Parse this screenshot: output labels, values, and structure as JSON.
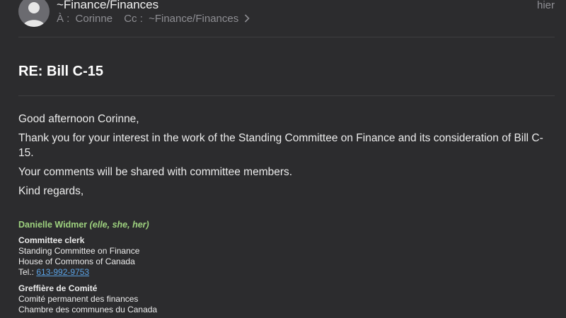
{
  "header": {
    "sender": "~Finance/Finances",
    "date": "hier",
    "to_label": "À :",
    "to_value": "Corinne",
    "cc_label": "Cc :",
    "cc_value": "~Finance/Finances",
    "avatar_icon": "person-icon"
  },
  "subject": "RE: Bill C-15",
  "body": {
    "greeting": "Good afternoon Corinne,",
    "paragraph1": "Thank you for your interest in the work of the Standing Committee on Finance and its consideration of Bill C-15.",
    "paragraph2": "Your comments will be shared with committee members.",
    "closing": "Kind regards,"
  },
  "signature": {
    "name": "Danielle Widmer",
    "pronouns": "(elle, she, her)",
    "en": {
      "title": "Committee clerk",
      "line1": "Standing Committee on Finance",
      "line2": "House of Commons of Canada",
      "tel_label": "Tel.:",
      "tel": "613-992-9753"
    },
    "fr": {
      "title": "Greffière de Comité",
      "line1": "Comité permanent des finances",
      "line2": "Chambre des communes du Canada"
    }
  },
  "colors": {
    "background": "#2c2c2e",
    "signature_name": "#9ed27f",
    "link": "#5aa3e6",
    "muted": "#8e8e93"
  }
}
